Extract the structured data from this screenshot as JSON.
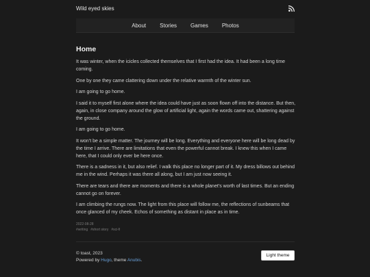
{
  "site_title": "Wild eyed skies",
  "rss_icon": "rss-icon",
  "nav": [
    {
      "label": "About"
    },
    {
      "label": "Stories"
    },
    {
      "label": "Games"
    },
    {
      "label": "Photos"
    }
  ],
  "post": {
    "title": "Home",
    "paragraphs": [
      "It was winter, when the icicles collected themselves that I first had the idea. It had been a long time coming.",
      "One by one they came clattering down under the relative warmth of the winter sun.",
      "I am going to go home.",
      "I said it to myself first alone where the idea could have just as soon flown off into the distance. But then, again, in close company around the glow of artificial light, again the words came out, shattering against the ground.",
      "I am going to go home.",
      "It won’t be a simple matter. The journey will be long. Everything and everyone here will be long dead by the time I arrive. There are limitations that even the powerful cannot break. I knew this when I came here, that I could only ever be here once.",
      "There is a sadness in it, but also relief. I walk this place no longer part of it. My dress billows out behind me in the wind. Perhaps it was there all along, but I am just now seeing it.",
      "There are tears and there are moments and there is a whole planet’s worth of last times. But an ending cannot go on forever.",
      "I am climbing the rungs now. The light from this place will follow me, the reflections of sunbeams that once glanced of my cheek. Echos of something as distant in place as in time."
    ],
    "date": "2022-08-28",
    "tags": [
      "#writing",
      "#short story",
      "#sci-fi"
    ]
  },
  "footer": {
    "copyright": "© toast, 2023",
    "powered_prefix": "Powered by ",
    "hugo": "Hugo",
    "theme_text": ", theme ",
    "anubis": "Anubis",
    "suffix": "."
  },
  "theme_button": "Light theme"
}
